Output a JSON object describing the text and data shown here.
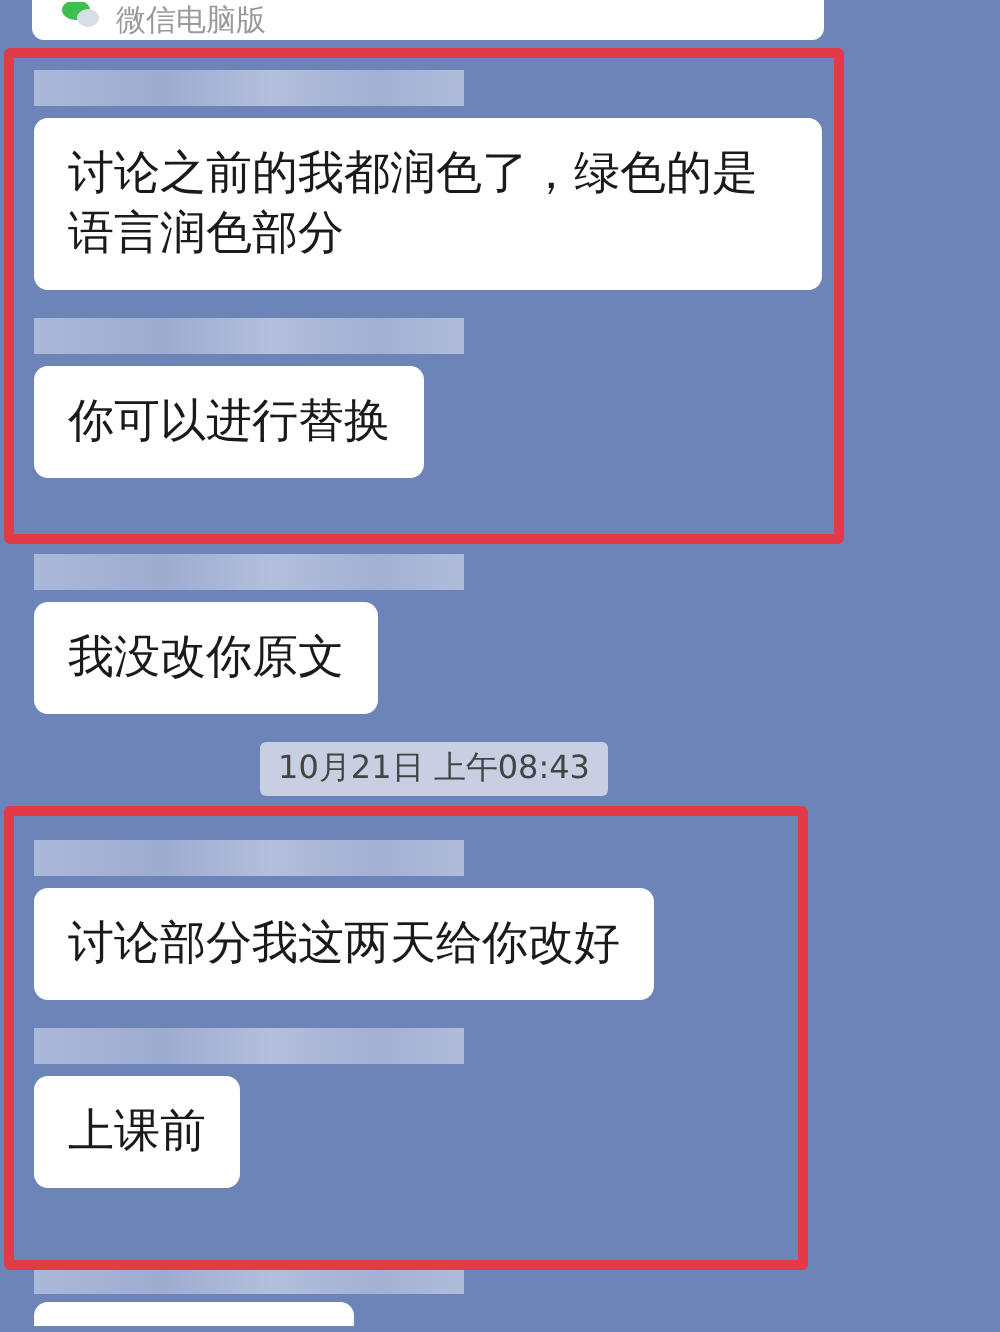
{
  "top_card": {
    "label": "微信电脑版"
  },
  "groups": [
    {
      "highlighted": true,
      "items": [
        {
          "kind": "message",
          "text": "讨论之前的我都润色了，绿色的是语言润色部分"
        },
        {
          "kind": "message",
          "text": "你可以进行替换"
        }
      ]
    },
    {
      "highlighted": false,
      "items": [
        {
          "kind": "message",
          "text": "我没改你原文"
        },
        {
          "kind": "time",
          "text": "10月21日 上午08:43"
        }
      ]
    },
    {
      "highlighted": true,
      "items": [
        {
          "kind": "message",
          "text": "讨论部分我这两天给你改好"
        },
        {
          "kind": "message",
          "text": "上课前"
        }
      ]
    },
    {
      "highlighted": false,
      "items": [
        {
          "kind": "partial"
        }
      ]
    }
  ]
}
